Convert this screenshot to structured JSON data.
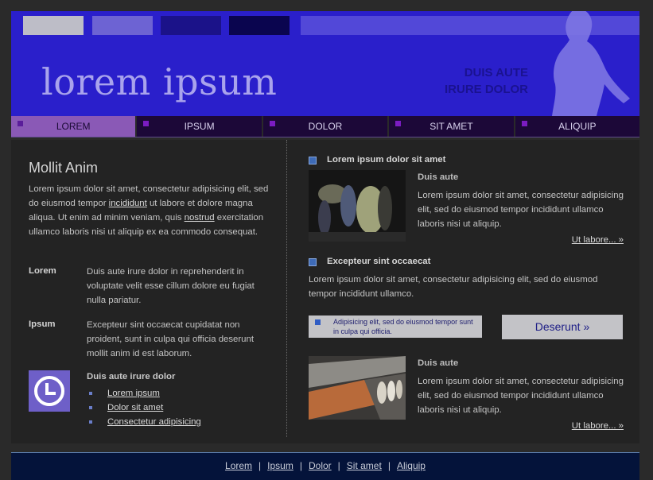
{
  "header": {
    "logo": "lorem ipsum",
    "tagline_line1": "DUIS AUTE",
    "tagline_line2": "IRURE DOLOR"
  },
  "nav": {
    "items": [
      {
        "label": "LOREM",
        "active": true
      },
      {
        "label": "IPSUM",
        "active": false
      },
      {
        "label": "DOLOR",
        "active": false
      },
      {
        "label": "SIT AMET",
        "active": false
      },
      {
        "label": "ALIQUIP",
        "active": false
      }
    ]
  },
  "left": {
    "title": "Mollit Anim",
    "intro": {
      "part1": "Lorem ipsum dolor sit amet, consectetur adipisicing elit, sed do eiusmod tempor ",
      "link1": "incididunt",
      "part2": " ut labore et dolore magna aliqua. Ut enim ad minim veniam, quis ",
      "link2": "nostrud",
      "part3": " exercitation ullamco laboris nisi ut aliquip ex ea commodo consequat."
    },
    "defs": [
      {
        "term": "Lorem",
        "text": "Duis aute irure dolor in reprehenderit in voluptate velit esse cillum dolore eu fugiat nulla pariatur."
      },
      {
        "term": "Ipsum",
        "text": "Excepteur sint occaecat cupidatat non proident, sunt in culpa qui officia deserunt mollit anim id est laborum."
      }
    ],
    "subhead": "Duis aute irure dolor",
    "links": [
      "Lorem ipsum",
      "Dolor sit amet",
      "Consectetur adipisicing"
    ]
  },
  "right": {
    "block1": {
      "heading": "Lorem ipsum dolor sit amet",
      "subhead": "Duis aute",
      "text": "Lorem ipsum dolor sit amet, consectetur adipisicing elit, sed do eiusmod tempor incididunt ullamco laboris nisi ut aliquip.",
      "more": "Ut labore... »"
    },
    "block2": {
      "heading": "Excepteur sint occaecat",
      "text": "Lorem ipsum dolor sit amet, consectetur adipisicing elit, sed do eiusmod tempor incididunt ullamco."
    },
    "notice": "Adipisicing elit, sed do eiusmod tempor sunt in culpa qui officia.",
    "button": "Deserunt »",
    "block3": {
      "subhead": "Duis aute",
      "text": "Lorem ipsum dolor sit amet, consectetur adipisicing elit, sed do eiusmod tempor incididunt ullamco laboris nisi ut aliquip.",
      "more": "Ut labore... »"
    }
  },
  "footer": {
    "links": [
      "Lorem",
      "Ipsum",
      "Dolor",
      "Sit amet",
      "Aliquip"
    ],
    "separator": "|"
  },
  "colors": {
    "header_bg": "#2a1fcb",
    "nav_active": "#8a59b6",
    "footer_bg": "#04133a"
  }
}
